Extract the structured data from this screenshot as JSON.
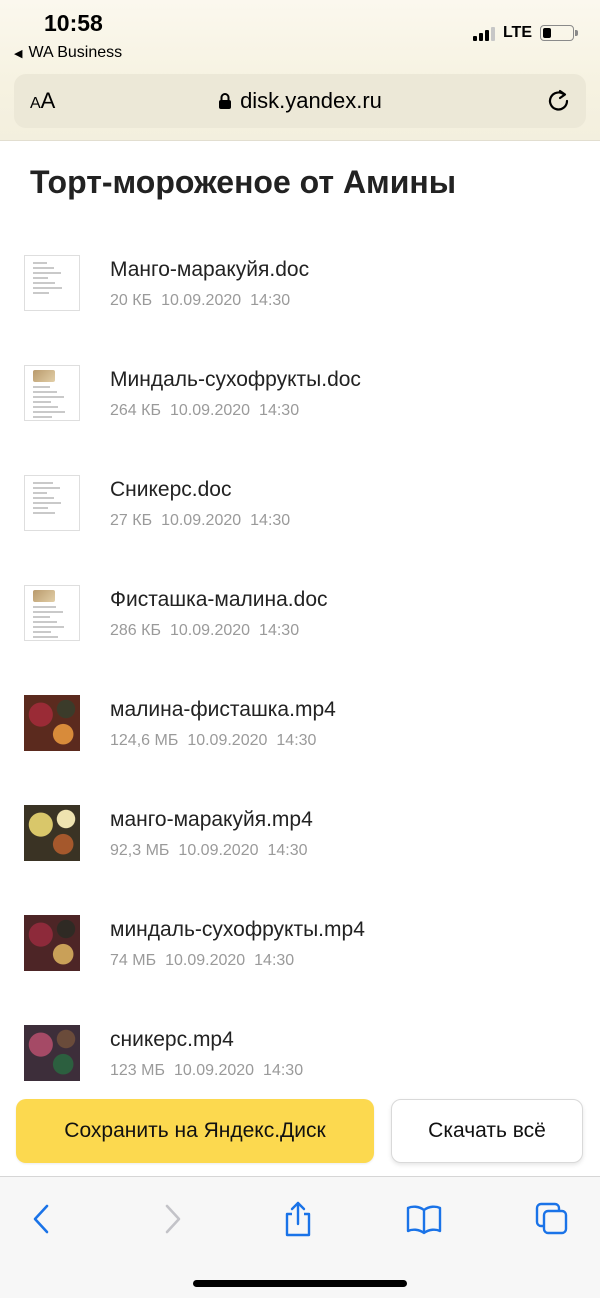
{
  "status_bar": {
    "time": "10:58",
    "back_app": "WA Business",
    "network": "LTE",
    "signal_bars": 3,
    "signal_bars_max": 4,
    "battery_fraction": 0.3
  },
  "browser": {
    "text_size_label_small": "A",
    "text_size_label_big": "A",
    "url": "disk.yandex.ru",
    "icons": [
      "lock-icon",
      "reload-icon",
      "back-icon",
      "forward-icon",
      "share-icon",
      "bookmarks-icon",
      "tabs-icon"
    ]
  },
  "page": {
    "title": "Торт-мороженое от Амины"
  },
  "files": [
    {
      "name": "Манго-маракуйя.doc",
      "size": "20 КБ",
      "date": "10.09.2020",
      "time": "14:30",
      "kind": "doc"
    },
    {
      "name": "Миндаль-сухофрукты.doc",
      "size": "264 КБ",
      "date": "10.09.2020",
      "time": "14:30",
      "kind": "doc"
    },
    {
      "name": "Сникерс.doc",
      "size": "27 КБ",
      "date": "10.09.2020",
      "time": "14:30",
      "kind": "doc"
    },
    {
      "name": "Фисташка-малина.doc",
      "size": "286 КБ",
      "date": "10.09.2020",
      "time": "14:30",
      "kind": "doc"
    },
    {
      "name": "малина-фисташка.mp4",
      "size": "124,6 МБ",
      "date": "10.09.2020",
      "time": "14:30",
      "kind": "video"
    },
    {
      "name": "манго-маракуйя.mp4",
      "size": "92,3 МБ",
      "date": "10.09.2020",
      "time": "14:30",
      "kind": "video"
    },
    {
      "name": "миндаль-сухофрукты.mp4",
      "size": "74 МБ",
      "date": "10.09.2020",
      "time": "14:30",
      "kind": "video"
    },
    {
      "name": "сникерс.mp4",
      "size": "123 МБ",
      "date": "10.09.2020",
      "time": "14:30",
      "kind": "video"
    }
  ],
  "actions": {
    "save_label": "Сохранить на Яндекс.Диск",
    "download_label": "Скачать всё"
  },
  "colors": {
    "save_button": "#fcd94f",
    "toolbar_accent": "#1a73e8",
    "meta_text": "#9a9a9a"
  }
}
